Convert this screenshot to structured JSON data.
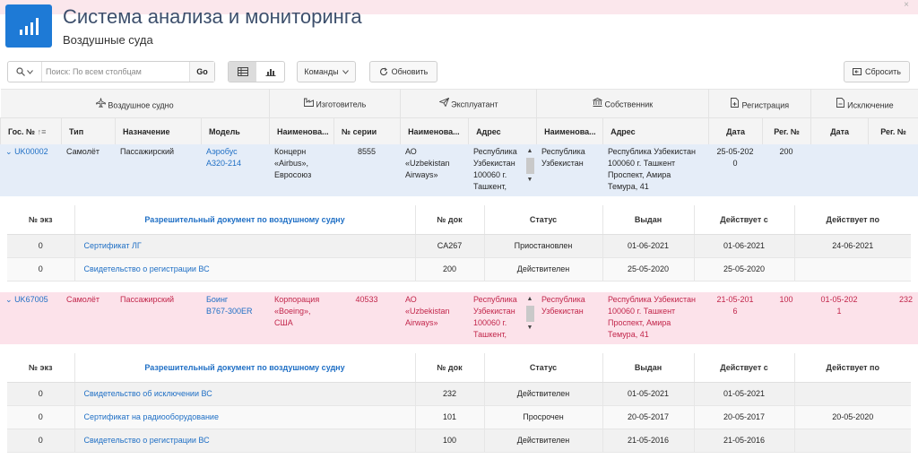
{
  "app": {
    "title": "Система анализа и мониторинга",
    "subtitle": "Воздушные суда",
    "close": "×"
  },
  "toolbar": {
    "search_placeholder": "Поиск: По всем столбцам",
    "go_label": "Go",
    "actions_label": "Команды",
    "refresh_label": "Обновить",
    "reset_label": "Сбросить"
  },
  "groups": {
    "aircraft": "Воздушное судно",
    "manufacturer": "Изготовитель",
    "operator": "Эксплуатант",
    "owner": "Собственник",
    "registration": "Регистрация",
    "exclusion": "Исключение"
  },
  "columns": {
    "reg_no": "Гос. №",
    "type": "Тип",
    "purpose": "Назначение",
    "model": "Модель",
    "mfr_name": "Наименова...",
    "serial": "№ серии",
    "op_name": "Наименова...",
    "op_address": "Адрес",
    "own_name": "Наименова...",
    "own_address": "Адрес",
    "reg_date": "Дата",
    "reg_num": "Рег. №",
    "exc_date": "Дата",
    "exc_num": "Рег. №"
  },
  "aircraft": [
    {
      "reg_no": "UK00002",
      "type": "Самолёт",
      "purpose": "Пассажирский",
      "model_1": "Аэробус",
      "model_2": "A320-214",
      "mfr_1": "Концерн",
      "mfr_2": "«Airbus»,",
      "mfr_3": "Евросоюз",
      "serial": "8555",
      "op_1": "АО",
      "op_2": "«Uzbekistan",
      "op_3": "Airways»",
      "opaddr_1": "Республика",
      "opaddr_2": "Узбекистан",
      "opaddr_3": "100060 г.",
      "opaddr_4": "Ташкент,",
      "own_1": "Республика",
      "own_2": "Узбекистан",
      "ownaddr_1": "Республика Узбекистан",
      "ownaddr_2": "100060 г. Ташкент",
      "ownaddr_3": "Проспект, Амира",
      "ownaddr_4": "Темура, 41",
      "reg_date_1": "25-05-202",
      "reg_date_2": "0",
      "reg_num": "200",
      "exc_date_1": "",
      "exc_date_2": "",
      "exc_num": ""
    },
    {
      "reg_no": "UK67005",
      "type": "Самолёт",
      "purpose": "Пассажирский",
      "model_1": "Боинг",
      "model_2": "B767-300ER",
      "mfr_1": "Корпорация",
      "mfr_2": "«Boeing»,",
      "mfr_3": "США",
      "serial": "40533",
      "op_1": "АО",
      "op_2": "«Uzbekistan",
      "op_3": "Airways»",
      "opaddr_1": "Республика",
      "opaddr_2": "Узбекистан",
      "opaddr_3": "100060 г.",
      "opaddr_4": "Ташкент,",
      "own_1": "Республика",
      "own_2": "Узбекистан",
      "ownaddr_1": "Республика Узбекистан",
      "ownaddr_2": "100060 г. Ташкент",
      "ownaddr_3": "Проспект, Амира",
      "ownaddr_4": "Темура, 41",
      "reg_date_1": "21-05-201",
      "reg_date_2": "6",
      "reg_num": "100",
      "exc_date_1": "01-05-202",
      "exc_date_2": "1",
      "exc_num": "232"
    }
  ],
  "detail_headers": {
    "copy_no": "№ экз",
    "document": "Разрешительный документ по воздушному судну",
    "doc_no": "№ док",
    "status": "Статус",
    "issued": "Выдан",
    "valid_from": "Действует с",
    "valid_to": "Действует по"
  },
  "detail_1": [
    {
      "copy": "0",
      "doc": "Сертификат ЛГ",
      "doc_no": "CA267",
      "status": "Приостановлен",
      "issued": "01-06-2021",
      "from": "01-06-2021",
      "to": "24-06-2021"
    },
    {
      "copy": "0",
      "doc": "Свидетельство о регистрации ВС",
      "doc_no": "200",
      "status": "Действителен",
      "issued": "25-05-2020",
      "from": "25-05-2020",
      "to": ""
    }
  ],
  "detail_2": [
    {
      "copy": "0",
      "doc": "Свидетельство об исключении ВС",
      "doc_no": "232",
      "status": "Действителен",
      "issued": "01-05-2021",
      "from": "01-05-2021",
      "to": ""
    },
    {
      "copy": "0",
      "doc": "Сертификат на радиооборудование",
      "doc_no": "101",
      "status": "Просрочен",
      "issued": "20-05-2017",
      "from": "20-05-2017",
      "to": "20-05-2020"
    },
    {
      "copy": "0",
      "doc": "Свидетельство о регистрации ВС",
      "doc_no": "100",
      "status": "Действителен",
      "issued": "21-05-2016",
      "from": "21-05-2016",
      "to": ""
    }
  ]
}
